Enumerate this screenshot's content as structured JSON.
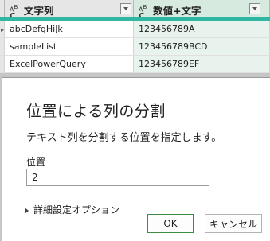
{
  "grid": {
    "columns": [
      {
        "type_icon": "ABC",
        "label": "文字列"
      },
      {
        "type_icon": "ABC",
        "label": "数値+文字"
      }
    ],
    "rows": [
      [
        "abcDefgHiJk",
        "123456789A"
      ],
      [
        "sampleList",
        "123456789BCD"
      ],
      [
        "ExcelPowerQuery",
        "123456789EF"
      ]
    ]
  },
  "dialog": {
    "title": "位置による列の分割",
    "description": "テキスト列を分割する位置を指定します。",
    "position_label": "位置",
    "position_value": "2",
    "advanced_options_label": "詳細設定オプション",
    "ok_label": "OK",
    "cancel_label": "キャンセル"
  },
  "colors": {
    "accent_teal": "#2fb7a1",
    "selected_column_bg": "#e7f3ec",
    "ok_border": "#3c8c44"
  }
}
